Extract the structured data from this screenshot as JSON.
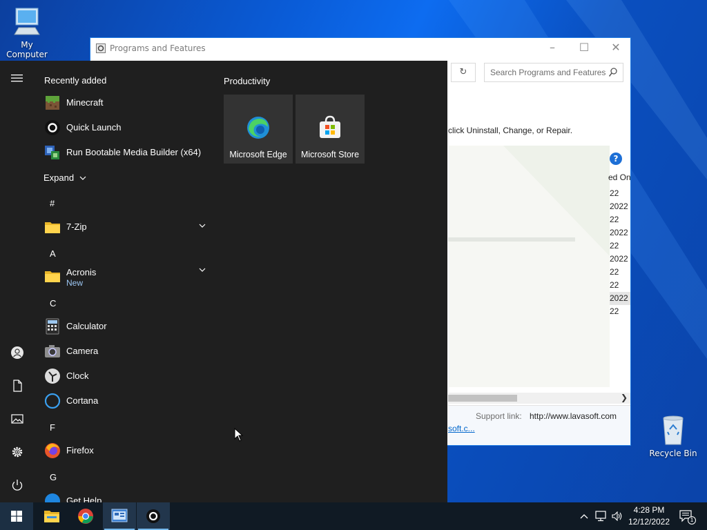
{
  "desktop": {
    "my_computer_label": "My Computer",
    "recycle_bin_label": "Recycle Bin"
  },
  "programs_window": {
    "title": "Programs and Features",
    "search_placeholder": "Search Programs and Features",
    "instructions_partial": "click Uninstall, Change, or Repair.",
    "help_glyph": "?",
    "column_header_partial": "ed On",
    "dates_partial": [
      "22",
      "2022",
      "22",
      "2022",
      "22",
      "2022",
      "22",
      "22",
      "2022",
      "22"
    ],
    "selected_date_index": 8,
    "support_link_label": "Support link:",
    "support_link_value": "http://www.lavasoft.com",
    "link_partial": "soft.c..."
  },
  "start_menu": {
    "recently_added_label": "Recently added",
    "recent_apps": [
      {
        "name": "Minecraft",
        "icon": "minecraft-icon"
      },
      {
        "name": "Quick Launch",
        "icon": "quick-launch-icon"
      },
      {
        "name": "Run Bootable Media Builder (x64)",
        "icon": "media-builder-icon"
      }
    ],
    "expand_label": "Expand",
    "groups": {
      "hash": "#",
      "a": "A",
      "c": "C",
      "f": "F",
      "g": "G"
    },
    "apps": {
      "zip": "7-Zip",
      "acronis": "Acronis",
      "acronis_badge": "New",
      "calculator": "Calculator",
      "camera": "Camera",
      "clock": "Clock",
      "cortana": "Cortana",
      "firefox": "Firefox",
      "get_help": "Get Help"
    },
    "tiles_group_label": "Productivity",
    "tiles": [
      {
        "name": "Microsoft Edge",
        "icon": "edge-icon"
      },
      {
        "name": "Microsoft Store",
        "icon": "store-icon"
      }
    ]
  },
  "taskbar": {
    "pinned": [
      "file-explorer-icon",
      "chrome-icon",
      "control-panel-icon",
      "quick-launch-icon"
    ],
    "time": "4:28 PM",
    "date": "12/12/2022",
    "notification_count": "1"
  }
}
